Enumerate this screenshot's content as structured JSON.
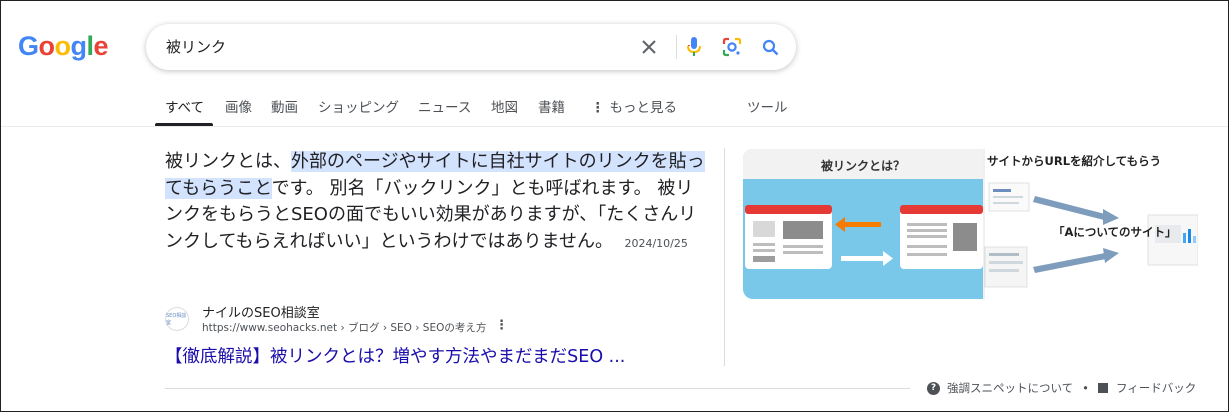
{
  "logo": {
    "text": "Google"
  },
  "search": {
    "query": "被リンク"
  },
  "tabs": [
    {
      "label": "すべて"
    },
    {
      "label": "画像"
    },
    {
      "label": "動画"
    },
    {
      "label": "ショッピング"
    },
    {
      "label": "ニュース"
    },
    {
      "label": "地図"
    },
    {
      "label": "書籍"
    },
    {
      "label": "もっと見る"
    },
    {
      "label": "ツール"
    }
  ],
  "snippet": {
    "pre": "被リンクとは、",
    "highlight": "外部のページやサイトに自社サイトのリンクを貼ってもらうこと",
    "post": "です。 別名「バックリンク」とも呼ばれます。 被リンクをもらうとSEOの面でもいい効果がありますが、「たくさんリンクしてもらえればいい」というわけではありません。",
    "date": "2024/10/25"
  },
  "source": {
    "name": "ナイルのSEO相談室",
    "url": "https://www.seohacks.net › ブログ › SEO › SEOの考え方",
    "favicon_text": "SEO相談室"
  },
  "result_title": "【徹底解説】被リンクとは？増やす方法やまだまだSEO ...",
  "image": {
    "left_title": "被リンクとは？",
    "right_title": "サイトからURLを紹介してもらう",
    "right_label": "「Aについてのサイト」"
  },
  "footer": {
    "about": "強調スニペットについて",
    "separator": "•",
    "feedback": "フィードバック"
  },
  "colors": {
    "google_blue": "#4285f4",
    "google_red": "#ea4335",
    "google_yellow": "#fbbc05",
    "google_green": "#34a853",
    "link": "#1a0dab",
    "highlight": "#d3e3fd",
    "image_sky": "#79c8ea"
  }
}
